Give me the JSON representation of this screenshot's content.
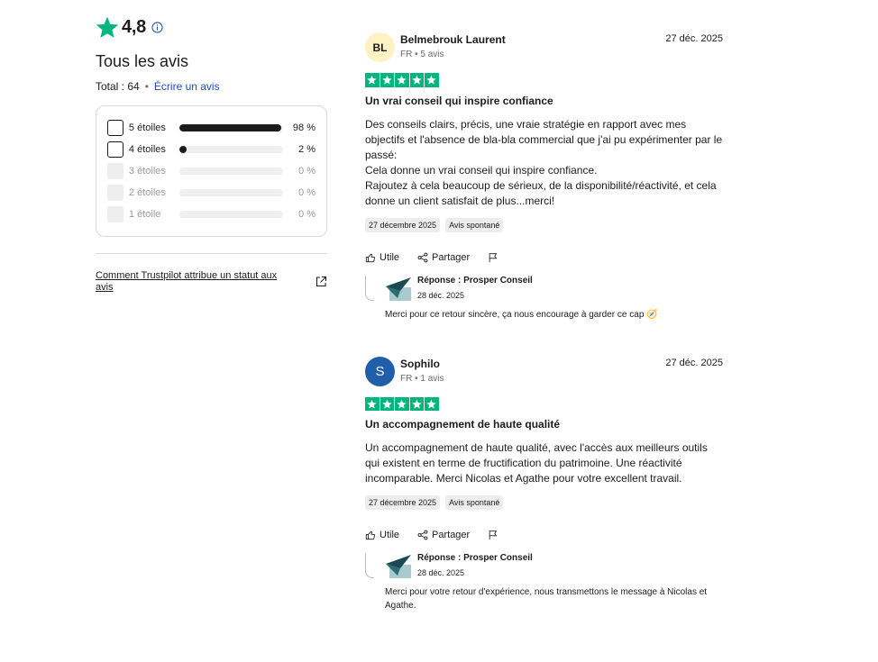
{
  "summary": {
    "rating": "4,8",
    "title": "Tous les avis",
    "total_label": "Total : 64",
    "separator": "•",
    "write_review": "Écrire un avis",
    "distribution": [
      {
        "label": "5 étoiles",
        "percent_label": "98 %",
        "percent": 98,
        "enabled": true
      },
      {
        "label": "4 étoiles",
        "percent_label": "2 %",
        "percent": 2,
        "enabled": true
      },
      {
        "label": "3 étoiles",
        "percent_label": "0 %",
        "percent": 0,
        "enabled": false
      },
      {
        "label": "2 étoiles",
        "percent_label": "0 %",
        "percent": 0,
        "enabled": false
      },
      {
        "label": "1 étoile",
        "percent_label": "0 %",
        "percent": 0,
        "enabled": false
      }
    ],
    "trust_link": "Comment Trustpilot attribue un statut aux avis"
  },
  "reviews": [
    {
      "initials": "BL",
      "author": "Belmebrouk Laurent",
      "meta": "FR • 5 avis",
      "date": "27 déc. 2025",
      "stars": 5,
      "title": "Un vrai conseil qui inspire confiance",
      "body_lines": [
        "Des conseils clairs, précis, une vraie stratégie en rapport avec mes objectifs et l'absence de bla-bla commercial que j'ai pu expérimenter par le passé:",
        "Cela donne un vrai conseil qui inspire confiance.",
        "Rajoutez à cela beaucoup de sérieux, de la disponibilité/réactivité, et cela donne un client satisfait de plus...merci!"
      ],
      "tag_date": "27 décembre 2025",
      "tag_type": "Avis spontané",
      "useful": "Utile",
      "share": "Partager",
      "reply": {
        "title": "Réponse : Prosper Conseil",
        "date": "28 déc. 2025",
        "text": "Merci pour ce retour sincère, ça nous encourage à garder ce cap 🧭"
      }
    },
    {
      "initials": "S",
      "author": "Sophilo",
      "meta": "FR • 1 avis",
      "date": "27 déc. 2025",
      "stars": 5,
      "title": "Un accompagnement de haute qualité",
      "body_lines": [
        "Un accompagnement de haute qualité, avec l'accès aux meilleurs outils qui existent en terme de fructification du patrimoine. Une réactivité incomparable. Merci Nicolas et Agathe pour votre excellent travail."
      ],
      "tag_date": "27 décembre 2025",
      "tag_type": "Avis spontané",
      "useful": "Utile",
      "share": "Partager",
      "reply": {
        "title": "Réponse : Prosper Conseil",
        "date": "28 déc. 2025",
        "text": "Merci pour votre retour d'expérience, nous transmettons le message à Nicolas et Agathe."
      }
    }
  ],
  "colors": {
    "trustpilot_green": "#00b67a",
    "link_blue": "#1c50b8",
    "bar_fill": "#1c1c1c"
  }
}
